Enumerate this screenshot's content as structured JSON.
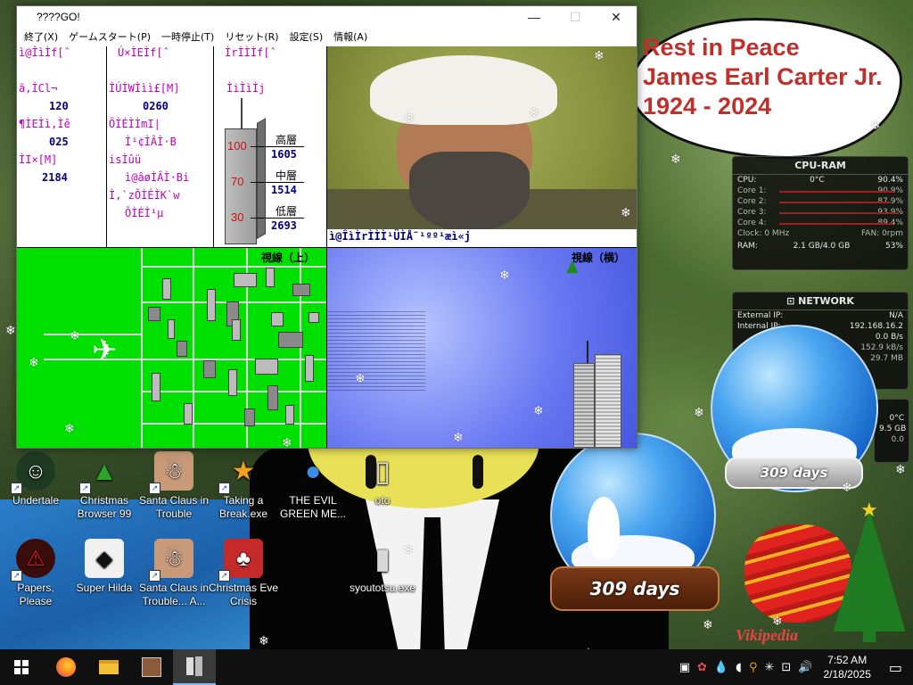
{
  "wallpaper": {
    "rip": {
      "line1": "Rest in Peace",
      "line2": "James Earl Carter Jr.",
      "line3": "1924 - 2024"
    },
    "globe_left_days": "309 days",
    "globe_right_days": "309 days",
    "vikipedia": "Vikipedia"
  },
  "cpu_gadget": {
    "title": "CPU-RAM",
    "cpu_label": "CPU:",
    "cpu_temp": "0°C",
    "cpu_pct": "90.4%",
    "cores": [
      {
        "label": "Core 1:",
        "value": "90.9%"
      },
      {
        "label": "Core 2:",
        "value": "87.9%"
      },
      {
        "label": "Core 3:",
        "value": "93.9%"
      },
      {
        "label": "Core 4:",
        "value": "89.4%"
      }
    ],
    "clock": "Clock: 0 MHz",
    "fan": "FAN: 0rpm",
    "ram_label": "RAM:",
    "ram_value": "2.1 GB/4.0 GB",
    "ram_pct": "53%"
  },
  "net_gadget": {
    "title": "NETWORK",
    "external_label": "External IP:",
    "external_value": "N/A",
    "internal_label": "Internal IP:",
    "internal_value": "192.168.16.2",
    "speed1": "0.0 B/s",
    "speed2": "152.9 kB/s",
    "speed3": "29.7 MB"
  },
  "mini_gadget": {
    "temp": "0°C",
    "size": "9.5 GB",
    "pct": "0.0"
  },
  "desktop_icons": [
    {
      "name": "Undertale",
      "glyph": "☺"
    },
    {
      "name": "Christmas Browser 99",
      "glyph": "▲"
    },
    {
      "name": "Santa Claus in Trouble",
      "glyph": "☃"
    },
    {
      "name": "Taking a Break.exe",
      "glyph": "★"
    },
    {
      "name": "THE EVIL GREEN ME...",
      "glyph": "●"
    },
    {
      "name": "oto",
      "glyph": "▯"
    },
    {
      "name": "Papers, Please",
      "glyph": "⚠"
    },
    {
      "name": "Super Hilda",
      "glyph": "◆"
    },
    {
      "name": "Santa Claus in Trouble... A...",
      "glyph": "☃"
    },
    {
      "name": "Christmas Eve Crisis",
      "glyph": "♣"
    },
    {
      "name": "syoutotsu.exe",
      "glyph": "▮"
    }
  ],
  "app": {
    "title": "????GO!",
    "menu": [
      "終了(X)",
      "ゲームスタート(P)",
      "一時停止(T)",
      "リセット(R)",
      "設定(S)",
      "情報(A)"
    ],
    "status": {
      "col_a": {
        "head": "ì@ÎìÌf[ˆ",
        "l1": "ã‚ÌCl¬",
        "v1": "120",
        "l2": "¶ÌEÌì‚Ìê",
        "v2": "025",
        "l3": "ÌI×[M]",
        "v3": "2184"
      },
      "col_b": {
        "head": "Ú×ÌEÌf[ˆ",
        "l1": "ÌÚÌWÌìì£[M]",
        "v1": "0260",
        "l2": "ÕÌÉÌÌmI|",
        "l3": "Ì¹¢ÌÂÌ·B",
        "l4": "isÌûü",
        "l5": "ì@âøÌÂÌ·Bi",
        "l6": "Ì,`zÕÌÉÌK`w",
        "l7": "ÕÌÉÌ¹µ"
      },
      "col_c": {
        "head": "ÌrÌÌÌf[ˆ",
        "l1": "ÌiÌìÌj"
      },
      "floors": [
        {
          "tick": "100",
          "label": "高層",
          "value": "1605"
        },
        {
          "tick": "70",
          "label": "中層",
          "value": "1514"
        },
        {
          "tick": "30",
          "label": "低層",
          "value": "2693"
        }
      ]
    },
    "photo_caption": "ì@ÎìÌrÌÌÌ¹ÜÌÅ˜¹ºº¹æì«j",
    "top_view_label": "視線（上）",
    "side_view_label": "視線（横）"
  },
  "taskbar": {
    "time": "7:52 AM",
    "date": "2/18/2025"
  }
}
